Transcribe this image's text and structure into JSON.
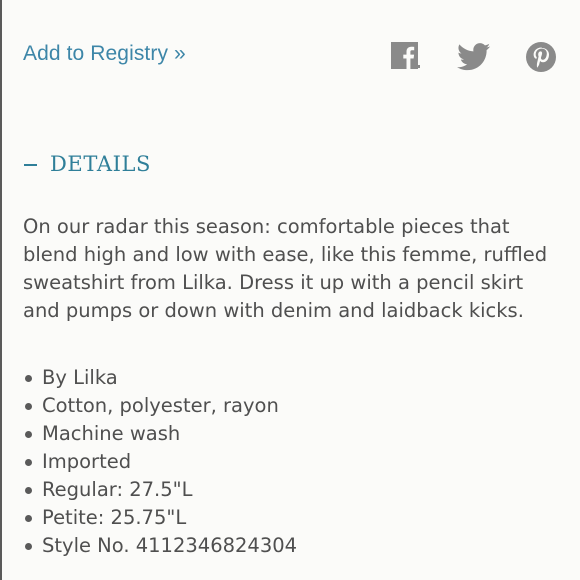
{
  "registry": {
    "link_label": "Add to Registry »"
  },
  "share": {
    "icons": [
      "facebook-icon",
      "twitter-icon",
      "pinterest-icon"
    ],
    "icon_color": "#8a8a8a"
  },
  "details": {
    "toggle_symbol": "–",
    "heading": "DETAILS",
    "heading_color": "#2f7f99",
    "description": "On our radar this season: comfortable pieces that blend high and low with ease, like this femme, ruffled sweatshirt from Lilka. Dress it up with a pencil skirt and pumps or down with denim and laidback kicks.",
    "features": [
      "By Lilka",
      "Cotton, polyester, rayon",
      "Machine wash",
      "Imported",
      "Regular: 27.5\"L",
      "Petite: 25.75\"L",
      "Style No. 4112346824304"
    ]
  },
  "colors": {
    "link": "#3d86a8",
    "text": "#4f4f4f",
    "background": "#fbfbf9"
  }
}
